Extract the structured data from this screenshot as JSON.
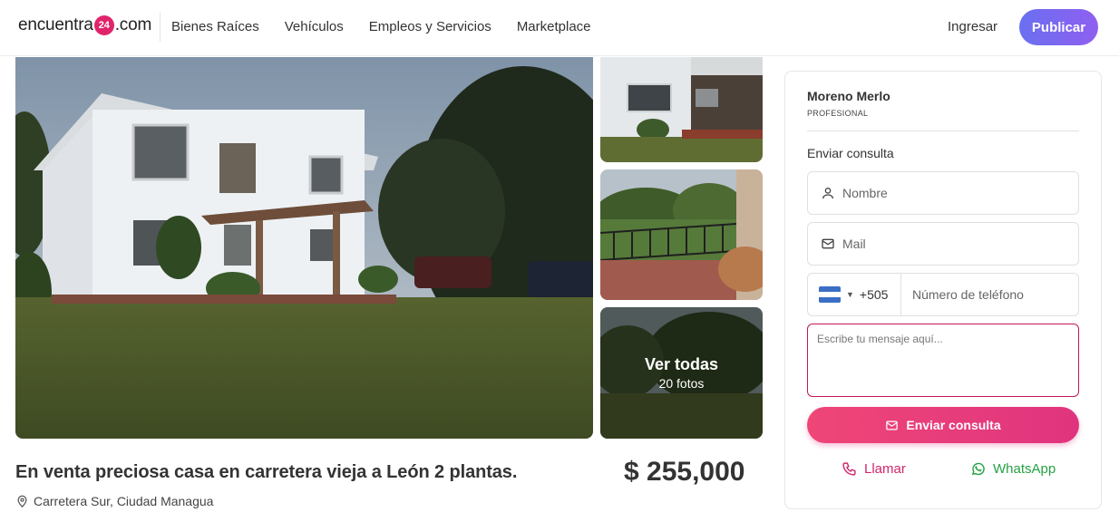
{
  "header": {
    "logo_prefix": "encuentra",
    "logo_badge": "24",
    "logo_suffix": ".com",
    "nav": [
      "Bienes Raíces",
      "Vehículos",
      "Empleos y Servicios",
      "Marketplace"
    ],
    "login_label": "Ingresar",
    "publish_label": "Publicar",
    "publish_gradient": [
      "#6a6ff0",
      "#8f5ff0"
    ]
  },
  "gallery": {
    "view_all_label": "Ver todas",
    "photo_count_label": "20 fotos"
  },
  "listing": {
    "title": "En venta preciosa casa en carretera vieja a León 2 plantas.",
    "price": "$ 255,000",
    "location": "Carretera Sur, Ciudad Managua"
  },
  "contact": {
    "seller_name": "Moreno Merlo",
    "seller_type": "PROFESIONAL",
    "heading": "Enviar consulta",
    "name_placeholder": "Nombre",
    "mail_placeholder": "Mail",
    "phone_code": "+505",
    "phone_placeholder": "Número de teléfono",
    "message_placeholder": "Escribe tu mensaje aquí...",
    "send_label": "Enviar consulta",
    "call_label": "Llamar",
    "whatsapp_label": "WhatsApp",
    "accent_color": "#e0347f",
    "whatsapp_color": "#25a244"
  }
}
